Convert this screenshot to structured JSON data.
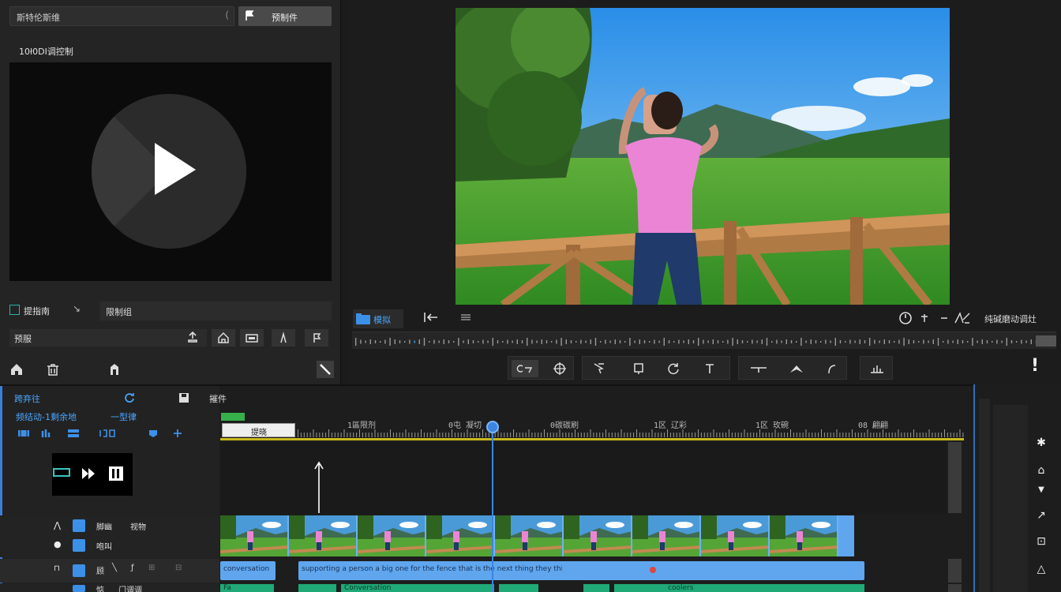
{
  "media_panel": {
    "search_text": "斯特伦斯维",
    "import_label": "预制件",
    "title": "10ł0DI调控制",
    "check_label": "提指南",
    "combo_label": "限制组",
    "name_label": "预服"
  },
  "viewer": {
    "tab_label": "模拟",
    "status_label": "纯碱磨动调灶"
  },
  "timeline": {
    "row1_label": "跨弃往",
    "row1_tab": "摧件",
    "row2_label_a": "频结动-1剩余地",
    "row2_label_b": "一型律",
    "search_label": "提晓",
    "ticks": [
      "1區限剂",
      "0屯 凝切",
      "0碳碳刷",
      "1区 辽彩",
      "1区 玫碗",
      "08 翩翩"
    ],
    "track_video_label_a": "脚幽",
    "track_video_label_b": "视物",
    "track_video2_label": "咆叫",
    "track_audio_label": "顾",
    "track_audio2_label": "惦",
    "track_audio2_extra": "门调调",
    "audio_clip1_text": "conversation",
    "audio_clip2_text": "supporting a person a big one for the fence that is the next thing they this",
    "green_clip_text": "Fa",
    "green_clip2_text": "Conversation",
    "green_clip3_text": "coolers"
  },
  "colors": {
    "accent_blue": "#3d85e0",
    "teal": "#2bb3a7",
    "ruler_yellow": "#c8b81c",
    "audio_blue": "#5fa6ef",
    "audio_green": "#1faa78"
  }
}
